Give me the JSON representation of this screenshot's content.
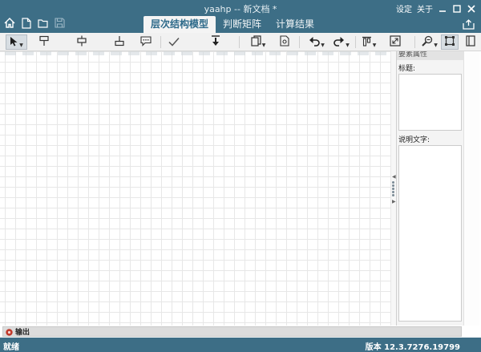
{
  "window": {
    "title": "yaahp -- 新文档 *",
    "links": [
      "设定",
      "关于"
    ]
  },
  "tabs": [
    {
      "label": "层次结构模型",
      "active": true
    },
    {
      "label": "判断矩阵",
      "active": false
    },
    {
      "label": "计算结果",
      "active": false
    }
  ],
  "toolbar_icons": [
    "pointer-icon",
    "top-node-icon",
    "middle-node-icon",
    "bottom-node-icon",
    "comment-icon",
    "check-icon",
    "arrow-down-icon",
    "copy-icon",
    "document-icon",
    "undo-icon",
    "redo-icon",
    "align-icon",
    "fit-icon",
    "zoom-icon",
    "frame-icon"
  ],
  "panel": {
    "header": "要素属性",
    "title_label": "标题:",
    "description_label": "说明文字:"
  },
  "output": {
    "label": "输出"
  },
  "status": {
    "left": "就绪",
    "version": "版本 12.3.7276.19799"
  },
  "colors": {
    "chrome": "#3d6e86",
    "tab_active_text": "#2e6a8a",
    "canvas": "#ffffff",
    "grid": "#e7e7e7"
  }
}
